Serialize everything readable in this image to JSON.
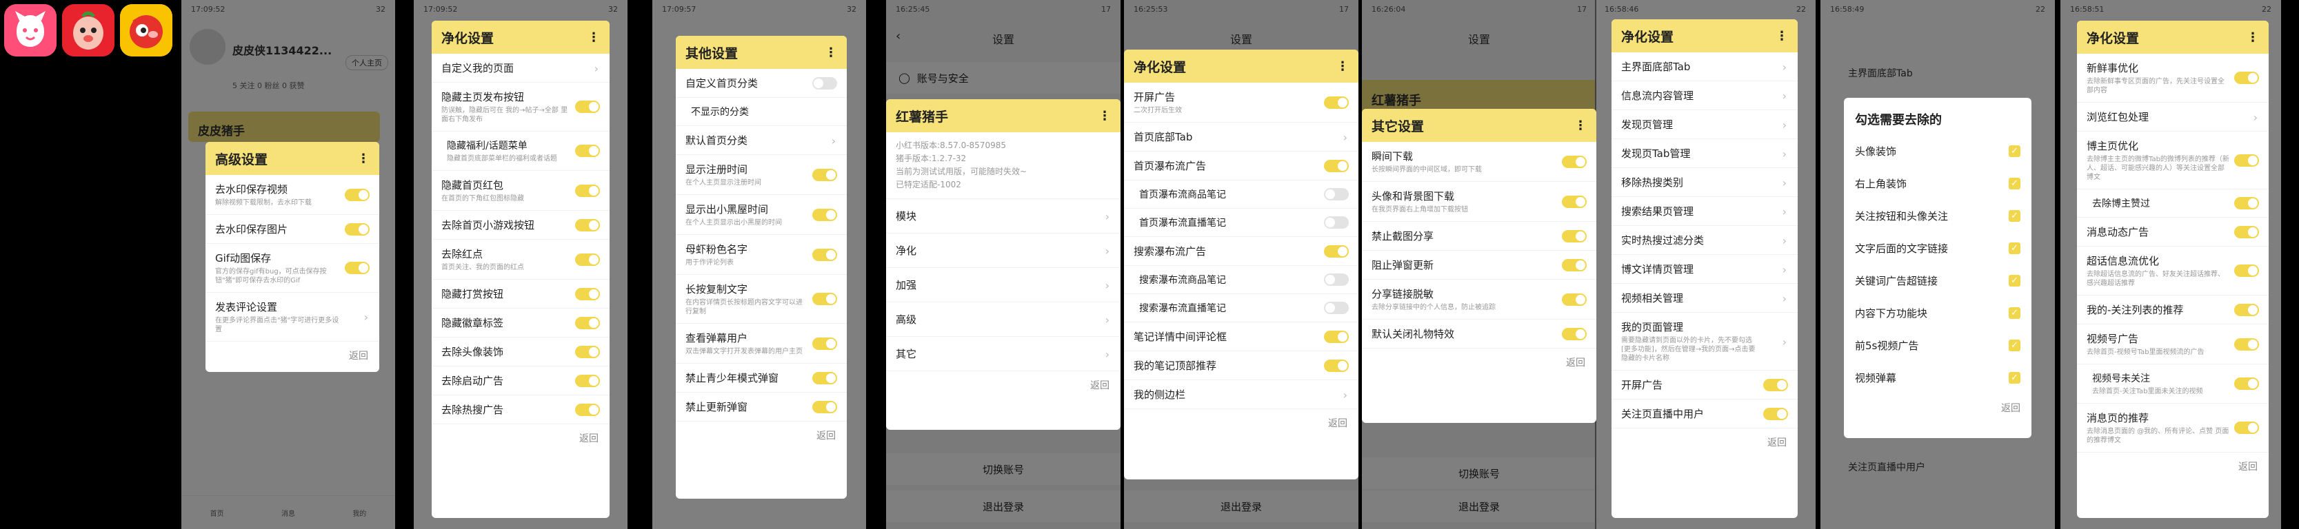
{
  "status": {
    "times": [
      "17:09:52",
      "17:09:52",
      "17:09:57",
      "16:25:45",
      "16:25:53",
      "16:26:04",
      "16:58:46",
      "16:58:49",
      "16:58:51"
    ],
    "battery": [
      "32",
      "32",
      "32",
      "17",
      "17",
      "17",
      "22",
      "22",
      "22"
    ]
  },
  "s1": {
    "username": "皮皮侠1134422...",
    "profile_btn": "个人主页",
    "stats": "5 关注   0 粉丝   0 获赞",
    "card_title": "皮皮猪手",
    "dialog_title": "高级设置",
    "rows": [
      {
        "t": "去水印保存视频",
        "d": "解除视频下载限制，去水印下载",
        "sw": true
      },
      {
        "t": "去水印保存图片",
        "d": "",
        "sw": true
      },
      {
        "t": "Gif动图保存",
        "d": "官方的保存gif有bug，可点击保存按钮\"猪\"即可保存去水印的Gif",
        "sw": true
      },
      {
        "t": "发表评论设置",
        "d": "在更多评论界面点击\"猪\"字可进行更多设置",
        "sw": false
      }
    ],
    "back": "返回",
    "nav": [
      "首页",
      "消息",
      "我的"
    ]
  },
  "s2": {
    "dialog_title": "净化设置",
    "rows": [
      {
        "t": "自定义我的页面",
        "d": "",
        "kind": "chev"
      },
      {
        "t": "隐藏主页发布按钮",
        "d": "防误触，隐藏后可在 我的→帖子→全部 里面右下角发布",
        "kind": "sw"
      },
      {
        "t": "隐藏福利/话题菜单",
        "d": "隐藏首页底部菜单栏的福利或者话题",
        "kind": "sw",
        "sub": true
      },
      {
        "t": "隐藏首页红包",
        "d": "在首页的下角红包图标隐藏",
        "kind": "sw"
      },
      {
        "t": "去除首页小游戏按钮",
        "d": "",
        "kind": "sw"
      },
      {
        "t": "去除红点",
        "d": "首页关注、我的页面的红点",
        "kind": "sw"
      },
      {
        "t": "隐藏打赏按钮",
        "d": "",
        "kind": "sw"
      },
      {
        "t": "隐藏徽章标签",
        "d": "",
        "kind": "sw"
      },
      {
        "t": "去除头像装饰",
        "d": "",
        "kind": "sw"
      },
      {
        "t": "去除启动广告",
        "d": "",
        "kind": "sw"
      },
      {
        "t": "去除热搜广告",
        "d": "",
        "kind": "sw"
      }
    ],
    "back": "返回"
  },
  "s3": {
    "dialog_title": "其他设置",
    "rows": [
      {
        "t": "自定义首页分类",
        "d": "",
        "kind": "swoff"
      },
      {
        "t": "不显示的分类",
        "d": "",
        "kind": "plain",
        "sub": true
      },
      {
        "t": "默认首页分类",
        "d": "",
        "kind": "chev"
      },
      {
        "t": "显示注册时间",
        "d": "在个人主页显示注册时间",
        "kind": "sw"
      },
      {
        "t": "显示出小黑屋时间",
        "d": "在个人主页显示出小黑屋的时间",
        "kind": "sw"
      },
      {
        "t": "母虾粉色名字",
        "d": "用于作评论列表",
        "kind": "sw"
      },
      {
        "t": "长按复制文字",
        "d": "在内容详情页长按标题内容文字可以进行复制",
        "kind": "sw"
      },
      {
        "t": "查看弹幕用户",
        "d": "双击弹幕文字打开发表弹幕的用户主页",
        "kind": "sw"
      },
      {
        "t": "禁止青少年模式弹窗",
        "d": "",
        "kind": "sw"
      },
      {
        "t": "禁止更新弹窗",
        "d": "",
        "kind": "sw"
      }
    ],
    "back": "返回"
  },
  "s4": {
    "header": "设置",
    "account": "账号与安全",
    "dialog_title": "红薯猪手",
    "info": [
      "小红书版本:8.57.0-8570985",
      "猪手版本:1.2.7-32",
      "当前为测试试用版，可能随时失效~",
      "已特定适配-1002"
    ],
    "menu": [
      "模块",
      "净化",
      "加强",
      "高级",
      "其它"
    ],
    "back": "返回",
    "switch_account": "切换账号",
    "logout": "退出登录"
  },
  "s5": {
    "header": "设置",
    "dialog_title": "净化设置",
    "rows": [
      {
        "t": "开屏广告",
        "d": "二次打开后生效",
        "kind": "sw"
      },
      {
        "t": "首页底部Tab",
        "d": "",
        "kind": "chev"
      },
      {
        "t": "首页瀑布流广告",
        "d": "",
        "kind": "sw"
      },
      {
        "t": "首页瀑布流商品笔记",
        "d": "",
        "kind": "swoff",
        "sub": true
      },
      {
        "t": "首页瀑布流直播笔记",
        "d": "",
        "kind": "swoff",
        "sub": true
      },
      {
        "t": "搜索瀑布流广告",
        "d": "",
        "kind": "sw"
      },
      {
        "t": "搜索瀑布流商品笔记",
        "d": "",
        "kind": "swoff",
        "sub": true
      },
      {
        "t": "搜索瀑布流直播笔记",
        "d": "",
        "kind": "swoff",
        "sub": true
      },
      {
        "t": "笔记详情中间评论框",
        "d": "",
        "kind": "sw"
      },
      {
        "t": "我的笔记顶部推荐",
        "d": "",
        "kind": "sw"
      },
      {
        "t": "我的侧边栏",
        "d": "",
        "kind": "chev"
      }
    ],
    "back": "返回",
    "logout": "退出登录"
  },
  "s6": {
    "header": "设置",
    "bg_title": "红薯猪手",
    "dialog_title": "其它设置",
    "rows": [
      {
        "t": "瞬间下载",
        "d": "长按瞬间界面的中间区域，即可下载",
        "kind": "sw"
      },
      {
        "t": "头像和背景图下载",
        "d": "在我页界面右上角增加下载按钮",
        "kind": "sw"
      },
      {
        "t": "禁止截图分享",
        "d": "",
        "kind": "sw"
      },
      {
        "t": "阻止弹窗更新",
        "d": "",
        "kind": "sw"
      },
      {
        "t": "分享链接脱敏",
        "d": "去除分享链接中的个人信息，防止被追踪",
        "kind": "sw"
      },
      {
        "t": "默认关闭礼物特效",
        "d": "",
        "kind": "sw"
      }
    ],
    "back": "返回",
    "switch_account": "切换账号",
    "logout": "退出登录"
  },
  "s7": {
    "dialog_title": "净化设置",
    "rows": [
      {
        "t": "主界面底部Tab",
        "d": "",
        "kind": "chev"
      },
      {
        "t": "信息流内容管理",
        "d": "",
        "kind": "chev"
      },
      {
        "t": "发现页管理",
        "d": "",
        "kind": "chev"
      },
      {
        "t": "发现页Tab管理",
        "d": "",
        "kind": "chev"
      },
      {
        "t": "移除热搜类别",
        "d": "",
        "kind": "chev"
      },
      {
        "t": "搜索结果页管理",
        "d": "",
        "kind": "chev"
      },
      {
        "t": "实时热搜过滤分类",
        "d": "",
        "kind": "chev"
      },
      {
        "t": "博文详情页管理",
        "d": "",
        "kind": "chev"
      },
      {
        "t": "视频相关管理",
        "d": "",
        "kind": "chev"
      },
      {
        "t": "我的页面管理",
        "d": "需要隐藏请到页面以外的卡片，先不要勾选[更多功能]，然后在管理→我的页面→点击要隐藏的卡片名称",
        "kind": "chev"
      },
      {
        "t": "开屏广告",
        "d": "",
        "kind": "sw"
      },
      {
        "t": "关注页直播中用户",
        "d": "",
        "kind": "sw"
      }
    ],
    "back": "返回"
  },
  "s8": {
    "bg_rows": [
      "主界面底部Tab",
      "关注页直播中用户"
    ],
    "dialog_title": "勾选需要去除的",
    "options": [
      "头像装饰",
      "右上角装饰",
      "关注按钮和头像关注",
      "文字后面的文字链接",
      "关键词广告超链接",
      "内容下方功能块",
      "前5s视频广告",
      "视频弹幕"
    ],
    "back": "返回"
  },
  "s9": {
    "dialog_title": "净化设置",
    "rows": [
      {
        "t": "新鲜事优化",
        "d": "去除新鲜事专区页面的广告，先关注号设置全部内容",
        "kind": "sw"
      },
      {
        "t": "浏览红包处理",
        "d": "",
        "kind": "chev"
      },
      {
        "t": "博主页优化",
        "d": "去除博主主页的微博Tab的微博列表的推荐（新人、超话、可能感兴趣的人）等关注设置全部博文",
        "kind": "sw"
      },
      {
        "t": "去除博主赞过",
        "d": "",
        "kind": "sw",
        "sub": true
      },
      {
        "t": "消息动态广告",
        "d": "",
        "kind": "sw"
      },
      {
        "t": "超话信息流优化",
        "d": "去除超话信息流的广告、好友关注超话推荐、感兴趣超话推荐",
        "kind": "sw"
      },
      {
        "t": "我的-关注列表的推荐",
        "d": "",
        "kind": "sw"
      },
      {
        "t": "视频号广告",
        "d": "去除首页-视频号Tab里面视频流的广告",
        "kind": "sw"
      },
      {
        "t": "视频号未关注",
        "d": "去除首页-关注Tab里面未关注的视频",
        "kind": "sw",
        "sub": true
      },
      {
        "t": "消息页的推荐",
        "d": "去除消息页面的 @我的、所有评论、点赞 页面的推荐博文",
        "kind": "sw"
      }
    ],
    "back": "返回"
  }
}
